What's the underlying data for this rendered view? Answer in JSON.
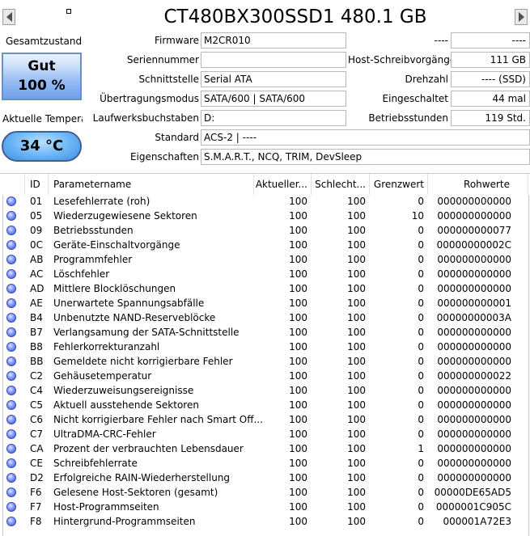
{
  "title": "CT480BX300SSD1 480.1 GB",
  "status": {
    "health_label": "Gesamtzustand",
    "health_value": "Gut",
    "health_percent": "100 %",
    "temp_label": "Aktuelle Temperat",
    "temp_value": "34 °C"
  },
  "info_left": [
    {
      "label": "Firmware",
      "value": "M2CR010"
    },
    {
      "label": "Seriennummer",
      "value": ""
    },
    {
      "label": "Schnittstelle",
      "value": "Serial ATA"
    },
    {
      "label": "Übertragungsmodus",
      "value": "SATA/600 | SATA/600"
    },
    {
      "label": "Laufwerksbuchstaben",
      "value": "D:"
    }
  ],
  "info_right": [
    {
      "label": "----",
      "value": "----"
    },
    {
      "label": "Host-Schreibvorgänge",
      "value": "111 GB"
    },
    {
      "label": "Drehzahl",
      "value": "---- (SSD)"
    },
    {
      "label": "Eingeschaltet",
      "value": "44 mal"
    },
    {
      "label": "Betriebsstunden",
      "value": "119 Std."
    }
  ],
  "standard": {
    "label": "Standard",
    "value": "ACS-2 | ----"
  },
  "features": {
    "label": "Eigenschaften",
    "value": "S.M.A.R.T., NCQ, TRIM, DevSleep"
  },
  "table": {
    "headers": [
      "ID",
      "Parametername",
      "Aktueller...",
      "Schlecht...",
      "Grenzwert",
      "Rohwerte"
    ],
    "rows": [
      {
        "id": "01",
        "name": "Lesefehlerrate (roh)",
        "cur": "100",
        "worst": "100",
        "thr": "0",
        "raw": "000000000000"
      },
      {
        "id": "05",
        "name": "Wiederzugewiesene Sektoren",
        "cur": "100",
        "worst": "100",
        "thr": "10",
        "raw": "000000000000"
      },
      {
        "id": "09",
        "name": "Betriebsstunden",
        "cur": "100",
        "worst": "100",
        "thr": "0",
        "raw": "000000000077"
      },
      {
        "id": "0C",
        "name": "Geräte-Einschaltvorgänge",
        "cur": "100",
        "worst": "100",
        "thr": "0",
        "raw": "00000000002C"
      },
      {
        "id": "AB",
        "name": "Programmfehler",
        "cur": "100",
        "worst": "100",
        "thr": "0",
        "raw": "000000000000"
      },
      {
        "id": "AC",
        "name": "Löschfehler",
        "cur": "100",
        "worst": "100",
        "thr": "0",
        "raw": "000000000000"
      },
      {
        "id": "AD",
        "name": "Mittlere Blocklöschungen",
        "cur": "100",
        "worst": "100",
        "thr": "0",
        "raw": "000000000000"
      },
      {
        "id": "AE",
        "name": "Unerwartete Spannungsabfälle",
        "cur": "100",
        "worst": "100",
        "thr": "0",
        "raw": "000000000001"
      },
      {
        "id": "B4",
        "name": "Unbenutzte NAND-Reserveblöcke",
        "cur": "100",
        "worst": "100",
        "thr": "0",
        "raw": "00000000003A"
      },
      {
        "id": "B7",
        "name": "Verlangsamung der SATA-Schnittstelle",
        "cur": "100",
        "worst": "100",
        "thr": "0",
        "raw": "000000000000"
      },
      {
        "id": "B8",
        "name": "Fehlerkorrekturanzahl",
        "cur": "100",
        "worst": "100",
        "thr": "0",
        "raw": "000000000000"
      },
      {
        "id": "BB",
        "name": "Gemeldete nicht korrigierbare Fehler",
        "cur": "100",
        "worst": "100",
        "thr": "0",
        "raw": "000000000000"
      },
      {
        "id": "C2",
        "name": "Gehäusetemperatur",
        "cur": "100",
        "worst": "100",
        "thr": "0",
        "raw": "000000000022"
      },
      {
        "id": "C4",
        "name": "Wiederzuweisungsereignisse",
        "cur": "100",
        "worst": "100",
        "thr": "0",
        "raw": "000000000000"
      },
      {
        "id": "C5",
        "name": "Aktuell ausstehende Sektoren",
        "cur": "100",
        "worst": "100",
        "thr": "0",
        "raw": "000000000000"
      },
      {
        "id": "C6",
        "name": "Nicht korrigierbare Fehler nach Smart Off...",
        "cur": "100",
        "worst": "100",
        "thr": "0",
        "raw": "000000000000"
      },
      {
        "id": "C7",
        "name": "UltraDMA-CRC-Fehler",
        "cur": "100",
        "worst": "100",
        "thr": "0",
        "raw": "000000000000"
      },
      {
        "id": "CA",
        "name": "Prozent der verbrauchten Lebensdauer",
        "cur": "100",
        "worst": "100",
        "thr": "1",
        "raw": "000000000000"
      },
      {
        "id": "CE",
        "name": "Schreibfehlerrate",
        "cur": "100",
        "worst": "100",
        "thr": "0",
        "raw": "000000000000"
      },
      {
        "id": "D2",
        "name": "Erfolgreiche RAIN-Wiederherstellung",
        "cur": "100",
        "worst": "100",
        "thr": "0",
        "raw": "000000000000"
      },
      {
        "id": "F6",
        "name": "Gelesene Host-Sektoren (gesamt)",
        "cur": "100",
        "worst": "100",
        "thr": "0",
        "raw": "00000DE65AD5"
      },
      {
        "id": "F7",
        "name": "Host-Programmseiten",
        "cur": "100",
        "worst": "100",
        "thr": "0",
        "raw": "0000001C905C"
      },
      {
        "id": "F8",
        "name": "Hintergrund-Programmseiten",
        "cur": "100",
        "worst": "100",
        "thr": "0",
        "raw": "000001A72E3"
      }
    ]
  },
  "colors": {
    "dot_blue": "#3a4fd8",
    "health_blue": "#6ea0ea",
    "temp_blue": "#3d8fe0"
  }
}
